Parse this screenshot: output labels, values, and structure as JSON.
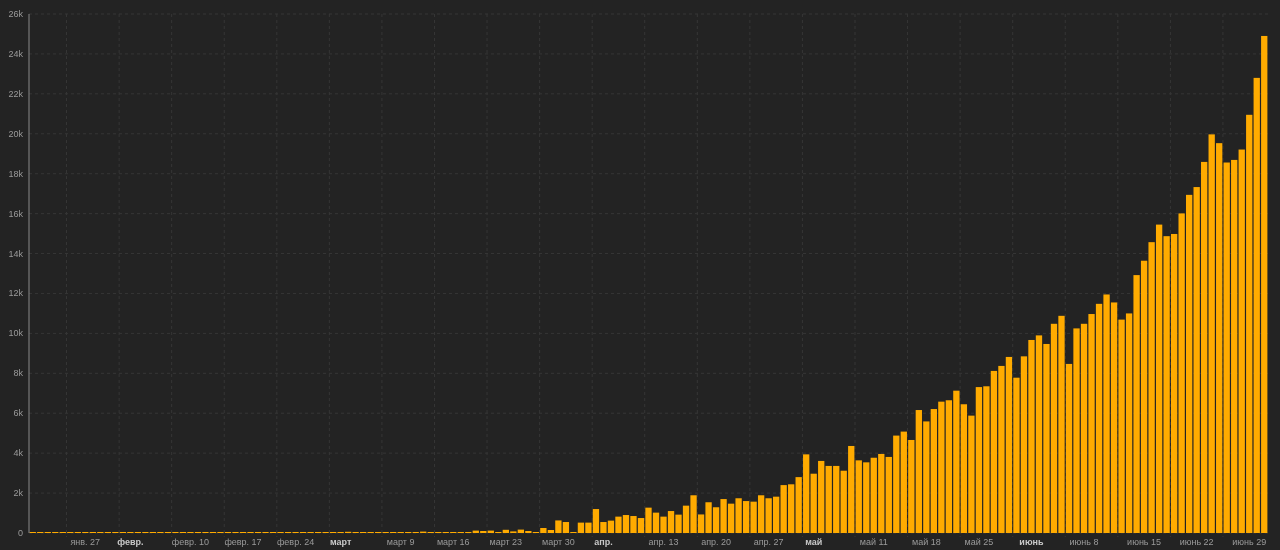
{
  "chart": {
    "chart_data": {
      "type": "bar",
      "grid": true,
      "categories": [
        null,
        null,
        null,
        null,
        null,
        null,
        null,
        "янв. 27",
        null,
        null,
        null,
        null,
        null,
        "**февр.**",
        null,
        null,
        null,
        null,
        null,
        null,
        null,
        "февр. 10",
        null,
        null,
        null,
        null,
        null,
        null,
        "февр. 17",
        null,
        null,
        null,
        null,
        null,
        null,
        "февр. 24",
        null,
        null,
        null,
        null,
        null,
        "**март**",
        null,
        null,
        null,
        null,
        null,
        null,
        null,
        "март 9",
        null,
        null,
        null,
        null,
        null,
        null,
        "март 16",
        null,
        null,
        null,
        null,
        null,
        null,
        "март 23",
        null,
        null,
        null,
        null,
        null,
        null,
        "март 30",
        null,
        null,
        null,
        null,
        null,
        "**апр.**",
        null,
        null,
        null,
        null,
        null,
        null,
        null,
        "апр. 13",
        null,
        null,
        null,
        null,
        null,
        null,
        "апр. 20",
        null,
        null,
        null,
        null,
        null,
        null,
        "апр. 27",
        null,
        null,
        null,
        null,
        null,
        "**май**",
        null,
        null,
        null,
        null,
        null,
        null,
        null,
        "май 11",
        null,
        null,
        null,
        null,
        null,
        null,
        "май 18",
        null,
        null,
        null,
        null,
        null,
        null,
        "май 25",
        null,
        null,
        null,
        null,
        null,
        null,
        "**июнь**",
        null,
        null,
        null,
        null,
        null,
        null,
        "июнь 8",
        null,
        null,
        null,
        null,
        null,
        null,
        null,
        "июнь 15",
        null,
        null,
        null,
        null,
        null,
        null,
        "июнь 22",
        null,
        null,
        null,
        null,
        null,
        null,
        "июнь 29",
        null,
        null
      ],
      "series": [
        {
          "color": "#ffab00",
          "values": [
            0,
            0,
            0,
            0,
            0,
            0,
            0,
            0,
            0,
            0,
            0,
            0,
            0,
            0,
            0,
            0,
            0,
            0,
            0,
            0,
            0,
            0,
            0,
            0,
            0,
            0,
            0,
            0,
            0,
            0,
            0,
            0,
            0,
            0,
            0,
            0,
            0,
            0,
            0,
            0,
            0,
            0,
            60,
            10,
            10,
            10,
            10,
            20,
            20,
            20,
            30,
            40,
            70,
            20,
            20,
            50,
            30,
            40,
            40,
            120,
            100,
            120,
            50,
            160,
            80,
            170,
            100,
            50,
            250,
            150,
            630,
            550,
            50,
            520,
            520,
            1200,
            550,
            620,
            820,
            900,
            850,
            750,
            1270,
            1020,
            820,
            1100,
            920,
            1370,
            1890,
            930,
            1540,
            1290,
            1700,
            1470,
            1740,
            1600,
            1570,
            1890,
            1740,
            1820,
            2400,
            2440,
            2800,
            3940,
            2970,
            3610,
            3360,
            3360,
            3120,
            4360,
            3640,
            3540,
            3770,
            3960,
            3810,
            4880,
            5080,
            4660,
            6160,
            5590,
            6210,
            6580,
            6650,
            7130,
            6450,
            5880,
            7310,
            7350,
            8120,
            8370,
            8820,
            7780,
            8850,
            9670,
            9900,
            9470,
            10480,
            10880,
            8470,
            10250,
            10480,
            10970,
            11480,
            11950,
            11550,
            10690,
            11000,
            12920,
            13640,
            14570,
            15450,
            14870,
            14980,
            16010,
            16940,
            17330,
            18590,
            19970,
            19530,
            18560,
            18690,
            19210,
            20950,
            22800,
            24900
          ]
        }
      ],
      "ylim": [
        0,
        26000
      ],
      "yticks": [
        {
          "value": 0,
          "label": "0"
        },
        {
          "value": 2000,
          "label": "2k"
        },
        {
          "value": 4000,
          "label": "4k"
        },
        {
          "value": 6000,
          "label": "6k"
        },
        {
          "value": 8000,
          "label": "8k"
        },
        {
          "value": 10000,
          "label": "10k"
        },
        {
          "value": 12000,
          "label": "12k"
        },
        {
          "value": 14000,
          "label": "14k"
        },
        {
          "value": 16000,
          "label": "16k"
        },
        {
          "value": 18000,
          "label": "18k"
        },
        {
          "value": 20000,
          "label": "20k"
        },
        {
          "value": 22000,
          "label": "22k"
        },
        {
          "value": 24000,
          "label": "24k"
        },
        {
          "value": 26000,
          "label": "26k"
        }
      ]
    }
  }
}
